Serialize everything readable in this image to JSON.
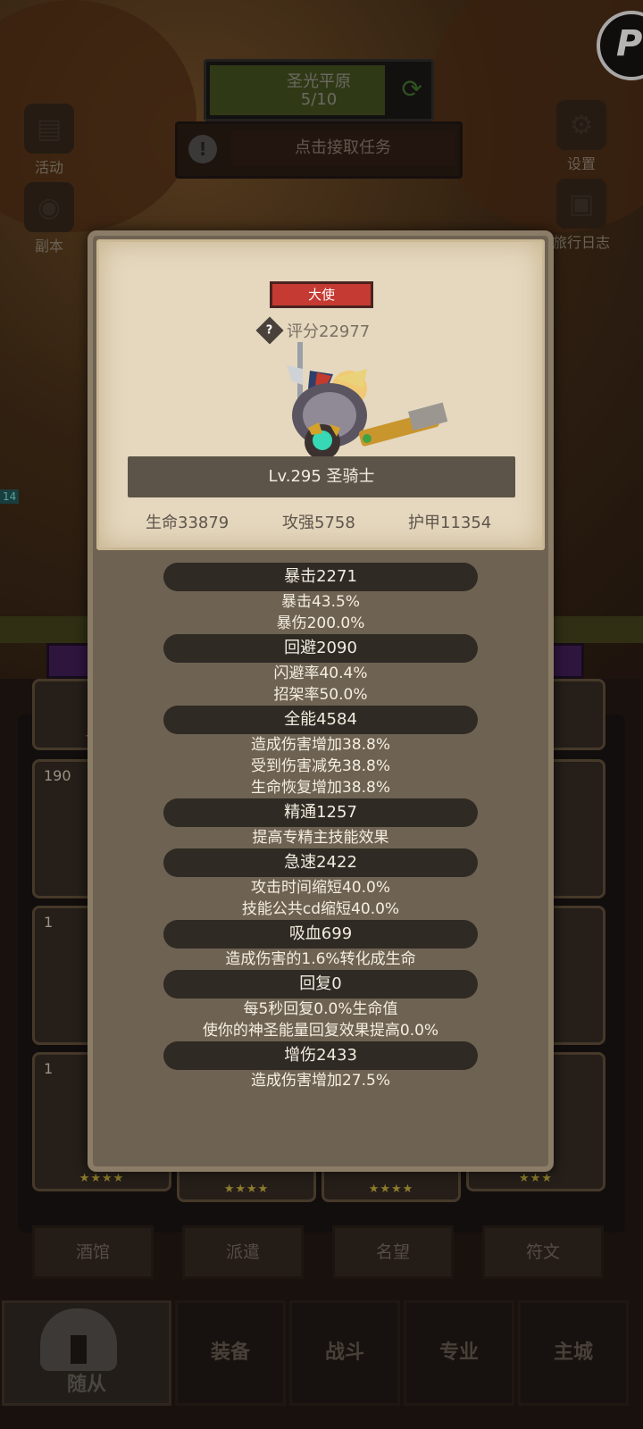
{
  "hud": {
    "zone_name": "圣光平原",
    "zone_progress": "5/10",
    "task_label": "点击接取任务",
    "left_buttons": [
      "活动",
      "副本"
    ],
    "right_buttons": [
      "设置",
      "旅行日志"
    ],
    "side_level": "14"
  },
  "roster_cards": [
    {
      "num": ""
    },
    {
      "num": "190"
    },
    {
      "num": "1"
    },
    {
      "num": "1"
    }
  ],
  "sub_tabs": [
    "酒馆",
    "派遣",
    "名望",
    "符文"
  ],
  "bottom_nav": {
    "active": "随从",
    "items": [
      "装备",
      "战斗",
      "专业",
      "主城"
    ]
  },
  "modal": {
    "rank": "大使",
    "score": "评分22977",
    "level_class": "Lv.295 圣骑士",
    "basic": {
      "hp": "生命33879",
      "atk": "攻强5758",
      "armor": "护甲11354"
    },
    "stats": [
      {
        "title": "暴击2271",
        "lines": [
          "暴击43.5%",
          "暴伤200.0%"
        ]
      },
      {
        "title": "回避2090",
        "lines": [
          "闪避率40.4%",
          "招架率50.0%"
        ]
      },
      {
        "title": "全能4584",
        "lines": [
          "造成伤害增加38.8%",
          "受到伤害减免38.8%",
          "生命恢复增加38.8%"
        ]
      },
      {
        "title": "精通1257",
        "lines": [
          "提高专精主技能效果"
        ]
      },
      {
        "title": "急速2422",
        "lines": [
          "攻击时间缩短40.0%",
          "技能公共cd缩短40.0%"
        ]
      },
      {
        "title": "吸血699",
        "lines": [
          "造成伤害的1.6%转化成生命"
        ]
      },
      {
        "title": "回复0",
        "lines": [
          "每5秒回复0.0%生命值",
          "使你的神圣能量回复效果提高0.0%"
        ]
      },
      {
        "title": "增伤2433",
        "lines": [
          "造成伤害增加27.5%"
        ]
      }
    ]
  },
  "colors": {
    "rank_badge": "#c53a33",
    "panel": "#6e6252",
    "parchment": "#e5d8bf"
  }
}
